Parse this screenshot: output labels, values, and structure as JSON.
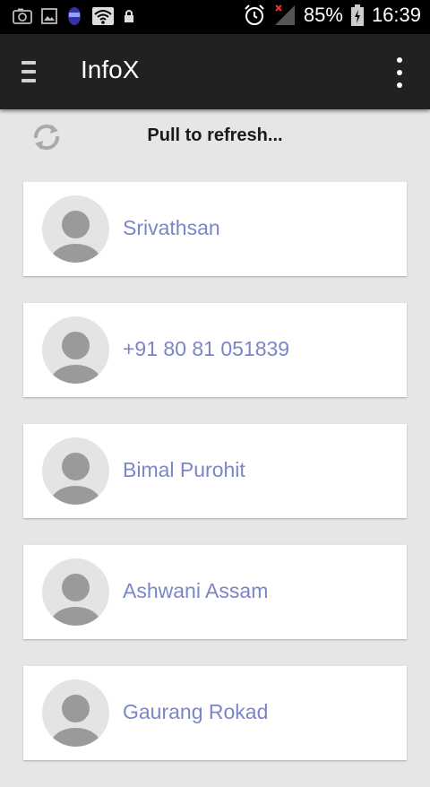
{
  "status_bar": {
    "battery": "85%",
    "time": "16:39",
    "icons": [
      "screenshot-icon",
      "image-icon",
      "app-icon",
      "wifi-icon",
      "lock-icon",
      "alarm-icon",
      "signal-icon",
      "battery-charging-icon"
    ]
  },
  "app_bar": {
    "title": "InfoX",
    "menu_icon": "hamburger-icon",
    "overflow_icon": "more-vert-icon"
  },
  "refresh": {
    "text": "Pull to refresh...",
    "icon": "refresh-icon"
  },
  "contacts": [
    {
      "name": "Srivathsan"
    },
    {
      "name": "+91 80 81 051839"
    },
    {
      "name": "Bimal Purohit"
    },
    {
      "name": "Ashwani Assam"
    },
    {
      "name": "Gaurang Rokad"
    }
  ],
  "colors": {
    "background": "#e6e6e6",
    "app_bar": "#212121",
    "contact_text": "#7a86c8",
    "avatar_bg": "#e4e4e4",
    "avatar_fg": "#9a9a9a"
  }
}
